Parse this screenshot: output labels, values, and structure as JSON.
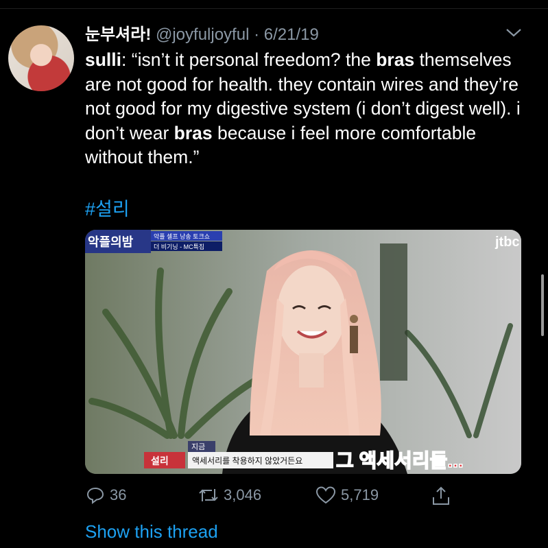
{
  "tweet": {
    "display_name": "눈부셔라!",
    "handle": "@joyfuljoyful",
    "separator": "·",
    "date": "6/21/19",
    "text": {
      "speaker": "sulli",
      "p1": ": “isn’t it personal freedom? the ",
      "bold1": "bras",
      "p2": " themselves are not good for health. they contain wires and they’re not good for my digestive system (i don’t digest well). i don’t wear ",
      "bold2": "bras",
      "p3": " because i feel more comfortable without them.”"
    },
    "hashtag": "#설리"
  },
  "media": {
    "show_logo": "악플의밤",
    "show_sub1": "악플 셀프 낭송 토크쇼",
    "show_sub2": "더 비기닝 - MC특집",
    "channel": "jtbc",
    "now_label": "지금",
    "name_tag": "설리",
    "caption": "액세서리를 착용하지 않았거든요",
    "big_caption": "그 액세서리들..."
  },
  "actions": {
    "replies": "36",
    "retweets": "3,046",
    "likes": "5,719"
  },
  "show_thread": "Show this thread",
  "icons": [
    "chevron-down-icon",
    "reply-icon",
    "retweet-icon",
    "like-icon",
    "share-icon"
  ],
  "colors": {
    "link": "#1da1f2",
    "muted": "#8b98a5",
    "background": "#000000"
  }
}
